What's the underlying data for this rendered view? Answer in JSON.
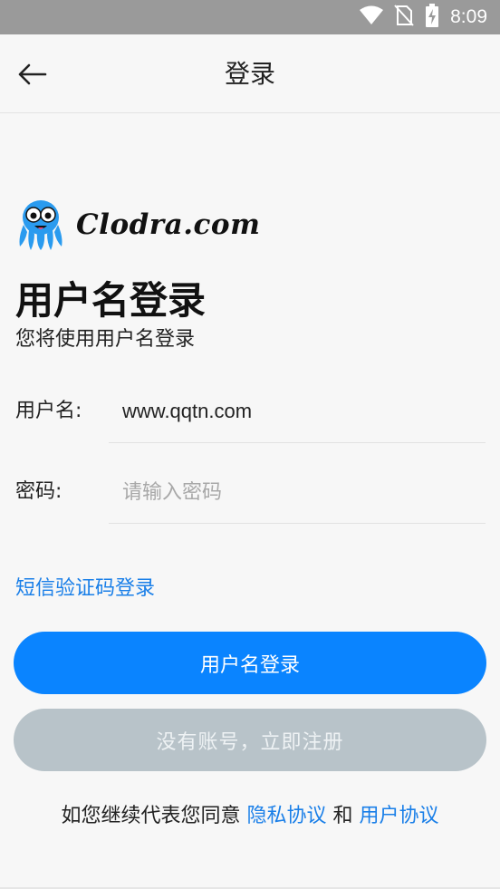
{
  "status_bar": {
    "time": "8:09",
    "icons": [
      "wifi-icon",
      "no-sim-icon",
      "battery-charging-icon"
    ]
  },
  "app_bar": {
    "title": "登录",
    "back_icon": "arrow-left-icon"
  },
  "logo": {
    "brand": "Clodra.com",
    "mascot_icon": "octopus-mascot-icon"
  },
  "heading": "用户名登录",
  "subheading": "您将使用用户名登录",
  "form": {
    "username": {
      "label": "用户名:",
      "value": "www.qqtn.com",
      "placeholder": ""
    },
    "password": {
      "label": "密码:",
      "value": "",
      "placeholder": "请输入密码"
    }
  },
  "sms_login_link": "短信验证码登录",
  "buttons": {
    "login": "用户名登录",
    "register": "没有账号，立即注册"
  },
  "agreement": {
    "prefix": "如您继续代表您同意 ",
    "privacy": "隐私协议",
    "and": " 和 ",
    "user": "用户协议"
  },
  "colors": {
    "primary": "#0a84ff",
    "link": "#1a7fe8",
    "disabled": "#b8c3c9",
    "status_bar": "#9a9a9a"
  }
}
